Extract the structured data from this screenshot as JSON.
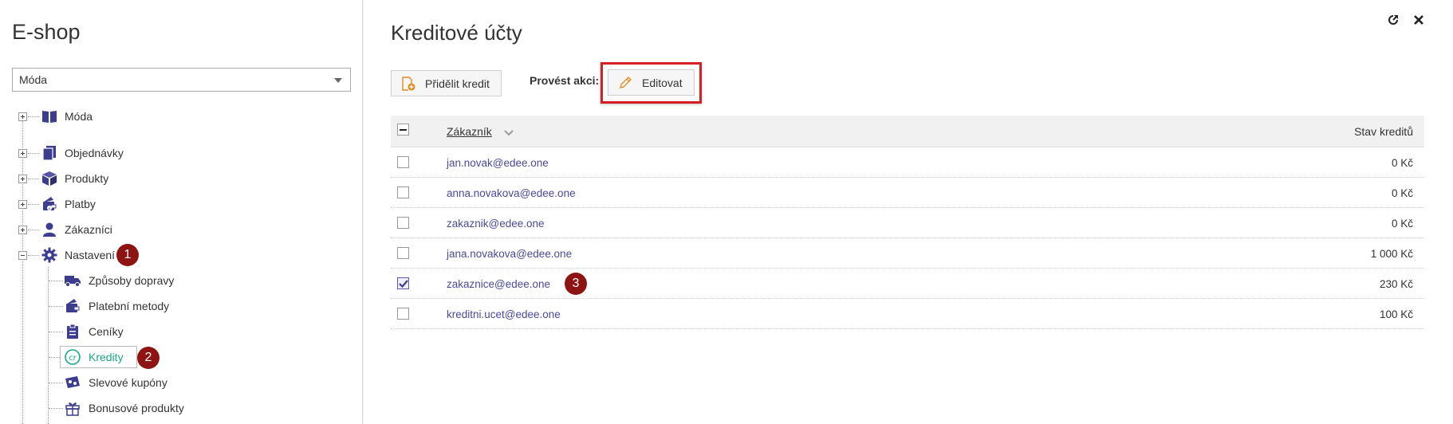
{
  "left_panel": {
    "title": "E-shop",
    "shop_select": {
      "value": "Móda"
    },
    "tree": {
      "root": {
        "label": "Móda"
      },
      "items": [
        {
          "label": "Objednávky",
          "icon": "orders-icon"
        },
        {
          "label": "Produkty",
          "icon": "box-icon"
        },
        {
          "label": "Platby",
          "icon": "wallet-icon"
        },
        {
          "label": "Zákazníci",
          "icon": "user-icon"
        },
        {
          "label": "Nastavení",
          "icon": "gear-icon"
        }
      ],
      "settings_children": [
        {
          "label": "Způsoby dopravy",
          "icon": "truck-icon"
        },
        {
          "label": "Platební metody",
          "icon": "wallet-icon"
        },
        {
          "label": "Ceníky",
          "icon": "clipboard-icon"
        },
        {
          "label": "Kredity",
          "icon": "credit-icon"
        },
        {
          "label": "Slevové kupóny",
          "icon": "coupon-icon"
        },
        {
          "label": "Bonusové produkty",
          "icon": "gift-icon"
        }
      ]
    },
    "badges": {
      "one": "1",
      "two": "2"
    }
  },
  "main": {
    "title": "Kreditové účty",
    "assign_button": "Přidělit kredit",
    "action_label": "Provést akci:",
    "edit_button": "Editovat",
    "table": {
      "header": {
        "customer": "Zákazník",
        "credit": "Stav kreditů"
      },
      "rows": [
        {
          "email": "jan.novak@edee.one",
          "credit": "0 Kč",
          "checked": false
        },
        {
          "email": "anna.novakova@edee.one",
          "credit": "0 Kč",
          "checked": false
        },
        {
          "email": "zakaznik@edee.one",
          "credit": "0 Kč",
          "checked": false
        },
        {
          "email": "jana.novakova@edee.one",
          "credit": "1 000 Kč",
          "checked": false
        },
        {
          "email": "zakaznice@edee.one",
          "credit": "230 Kč",
          "checked": true
        },
        {
          "email": "kreditni.ucet@edee.one",
          "credit": "100 Kč",
          "checked": false
        }
      ]
    },
    "badge_three": "3"
  },
  "colors": {
    "badge": "#8e1414",
    "highlight": "#d41f25",
    "active_item": "#1aa78a",
    "icon": "#3d3d8f",
    "link": "#4a4a9a"
  }
}
